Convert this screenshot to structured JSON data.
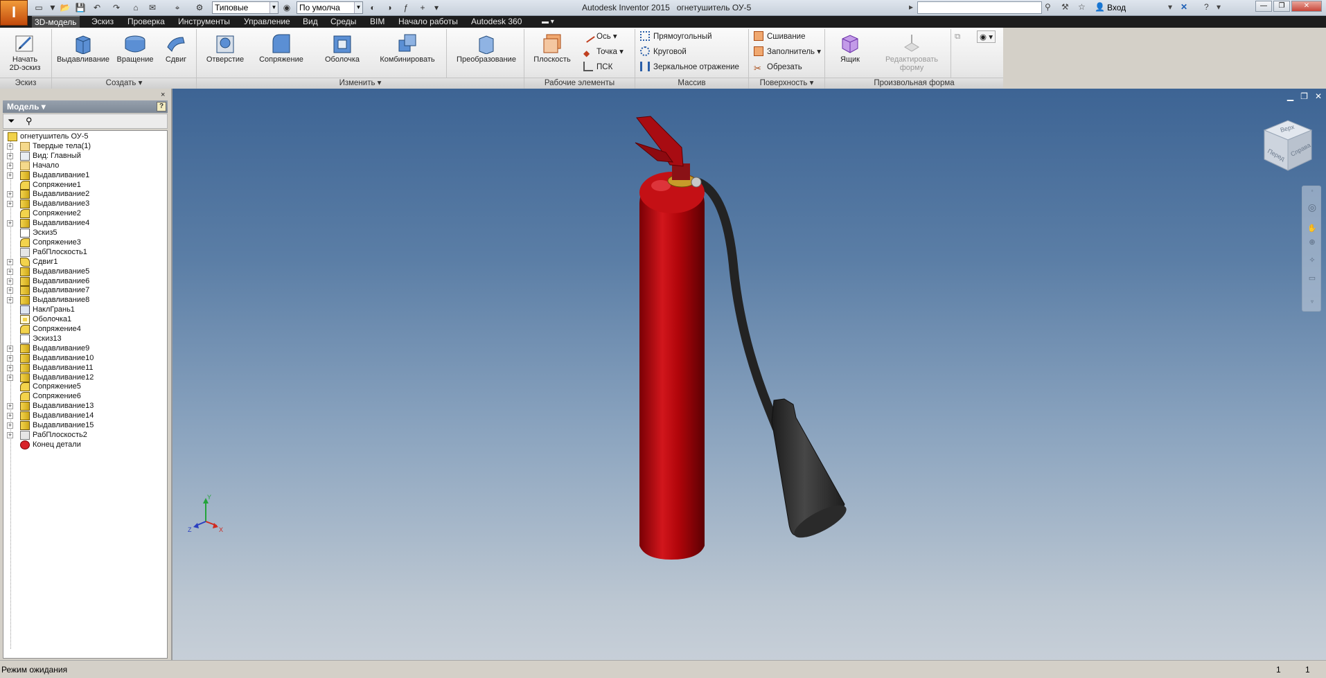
{
  "app": {
    "window_title": "Autodesk Inventor 2015   огнетушитель ОУ-5",
    "logo_letter": "I",
    "signin": "Вход",
    "style_combo": "Типовые",
    "appearance_combo": "По умолча"
  },
  "menu": {
    "tabs": [
      "3D-модель",
      "Эскиз",
      "Проверка",
      "Инструменты",
      "Управление",
      "Вид",
      "Среды",
      "BIM",
      "Начало работы",
      "Autodesk 360"
    ]
  },
  "ribbon": {
    "sketch": {
      "start_line1": "Начать",
      "start_line2": "2D-эскиз",
      "panel": "Эскиз"
    },
    "create": {
      "extrude": "Выдавливание",
      "revolve": "Вращение",
      "sweep": "Сдвиг",
      "panel": "Создать"
    },
    "modify": {
      "hole": "Отверстие",
      "fillet": "Сопряжение",
      "shell": "Оболочка",
      "combine": "Комбинировать",
      "panel": "Изменить"
    },
    "convert": {
      "label": "Преобразование"
    },
    "work": {
      "plane": "Плоскость",
      "axis": "Ось",
      "point": "Точка",
      "ucs": "ПСК",
      "panel": "Рабочие элементы"
    },
    "pattern": {
      "rect": "Прямоугольный",
      "circ": "Круговой",
      "mirror": "Зеркальное отражение",
      "panel": "Массив"
    },
    "surface": {
      "stitch": "Сшивание",
      "patch": "Заполнитель",
      "trim": "Обрезать",
      "panel": "Поверхность"
    },
    "freeform": {
      "box": "Ящик",
      "edit_line1": "Редактировать",
      "edit_line2": "форму",
      "panel": "Произвольная форма"
    }
  },
  "browser": {
    "title": "Модель",
    "close": "×",
    "help": "?",
    "items": [
      {
        "label": "огнетушитель ОУ-5",
        "icon": "part",
        "exp": ""
      },
      {
        "label": "Твердые тела(1)",
        "icon": "folder",
        "exp": "+"
      },
      {
        "label": "Вид: Главный",
        "icon": "view",
        "exp": "+"
      },
      {
        "label": "Начало",
        "icon": "folder",
        "exp": "+"
      },
      {
        "label": "Выдавливание1",
        "icon": "extrude",
        "exp": "+"
      },
      {
        "label": "Сопряжение1",
        "icon": "fillet",
        "exp": ""
      },
      {
        "label": "Выдавливание2",
        "icon": "extrude",
        "exp": "+"
      },
      {
        "label": "Выдавливание3",
        "icon": "extrude",
        "exp": "+"
      },
      {
        "label": "Сопряжение2",
        "icon": "fillet",
        "exp": ""
      },
      {
        "label": "Выдавливание4",
        "icon": "extrude",
        "exp": "+"
      },
      {
        "label": "Эскиз5",
        "icon": "sketch",
        "exp": ""
      },
      {
        "label": "Сопряжение3",
        "icon": "fillet",
        "exp": ""
      },
      {
        "label": "РабПлоскость1",
        "icon": "plane",
        "exp": ""
      },
      {
        "label": "Сдвиг1",
        "icon": "sweep",
        "exp": "+"
      },
      {
        "label": "Выдавливание5",
        "icon": "extrude",
        "exp": "+"
      },
      {
        "label": "Выдавливание6",
        "icon": "extrude",
        "exp": "+"
      },
      {
        "label": "Выдавливание7",
        "icon": "extrude",
        "exp": "+"
      },
      {
        "label": "Выдавливание8",
        "icon": "extrude",
        "exp": "+"
      },
      {
        "label": "НаклГрань1",
        "icon": "draft",
        "exp": ""
      },
      {
        "label": "Оболочка1",
        "icon": "shell",
        "exp": ""
      },
      {
        "label": "Сопряжение4",
        "icon": "fillet",
        "exp": ""
      },
      {
        "label": "Эскиз13",
        "icon": "sketch",
        "exp": ""
      },
      {
        "label": "Выдавливание9",
        "icon": "extrude",
        "exp": "+"
      },
      {
        "label": "Выдавливание10",
        "icon": "extrude",
        "exp": "+"
      },
      {
        "label": "Выдавливание11",
        "icon": "extrude",
        "exp": "+"
      },
      {
        "label": "Выдавливание12",
        "icon": "extrude",
        "exp": "+"
      },
      {
        "label": "Сопряжение5",
        "icon": "fillet",
        "exp": ""
      },
      {
        "label": "Сопряжение6",
        "icon": "fillet",
        "exp": ""
      },
      {
        "label": "Выдавливание13",
        "icon": "extrude",
        "exp": "+"
      },
      {
        "label": "Выдавливание14",
        "icon": "extrude",
        "exp": "+"
      },
      {
        "label": "Выдавливание15",
        "icon": "extrude",
        "exp": "+"
      },
      {
        "label": "РабПлоскость2",
        "icon": "plane",
        "exp": "+"
      },
      {
        "label": "Конец детали",
        "icon": "eop",
        "exp": ""
      }
    ]
  },
  "viewcube": {
    "top": "Верх",
    "front": "Перед",
    "right": "Справа"
  },
  "triad": {
    "x": "X",
    "y": "Y",
    "z": "Z"
  },
  "status": {
    "text": "Режим ожидания",
    "count1": "1",
    "count2": "1"
  },
  "colors": {
    "extinguisher_body": "#b0050a",
    "hose": "#222222",
    "background_top": "#3d6494",
    "background_bottom": "#c7cfd8"
  }
}
